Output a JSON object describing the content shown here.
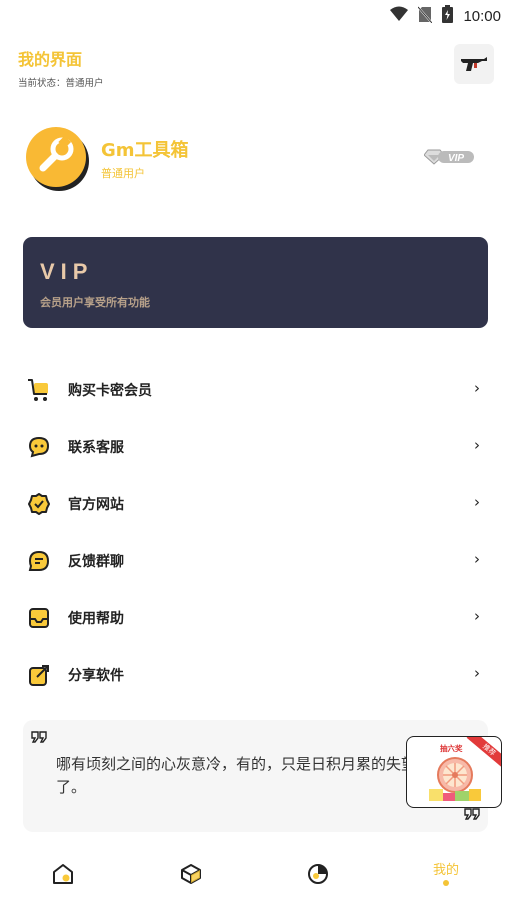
{
  "status_bar": {
    "time": "10:00"
  },
  "header": {
    "title": "我的界面",
    "subtitle": "当前状态：普通用户"
  },
  "profile": {
    "name": "Gm工具箱",
    "level": "普通用户",
    "badge": "VIP"
  },
  "vip_card": {
    "title": "VIP",
    "description": "会员用户享受所有功能"
  },
  "menu": [
    {
      "label": "购买卡密会员",
      "icon": "cart-icon"
    },
    {
      "label": "联系客服",
      "icon": "chat-icon"
    },
    {
      "label": "官方网站",
      "icon": "verified-badge-icon"
    },
    {
      "label": "反馈群聊",
      "icon": "feedback-icon"
    },
    {
      "label": "使用帮助",
      "icon": "inbox-icon"
    },
    {
      "label": "分享软件",
      "icon": "share-icon"
    }
  ],
  "menu_chevron": "›",
  "quote": {
    "text": "哪有顷刻之间的心灰意冷，有的，只是日积月累的失望罢了。"
  },
  "promo": {
    "title": "抽六奖",
    "ribbon": "推荐"
  },
  "tabbar": {
    "active_label": "我的"
  },
  "colors": {
    "accent": "#F4C437",
    "vip_card_bg": "#30334a",
    "vip_text": "#e8c9a9"
  }
}
